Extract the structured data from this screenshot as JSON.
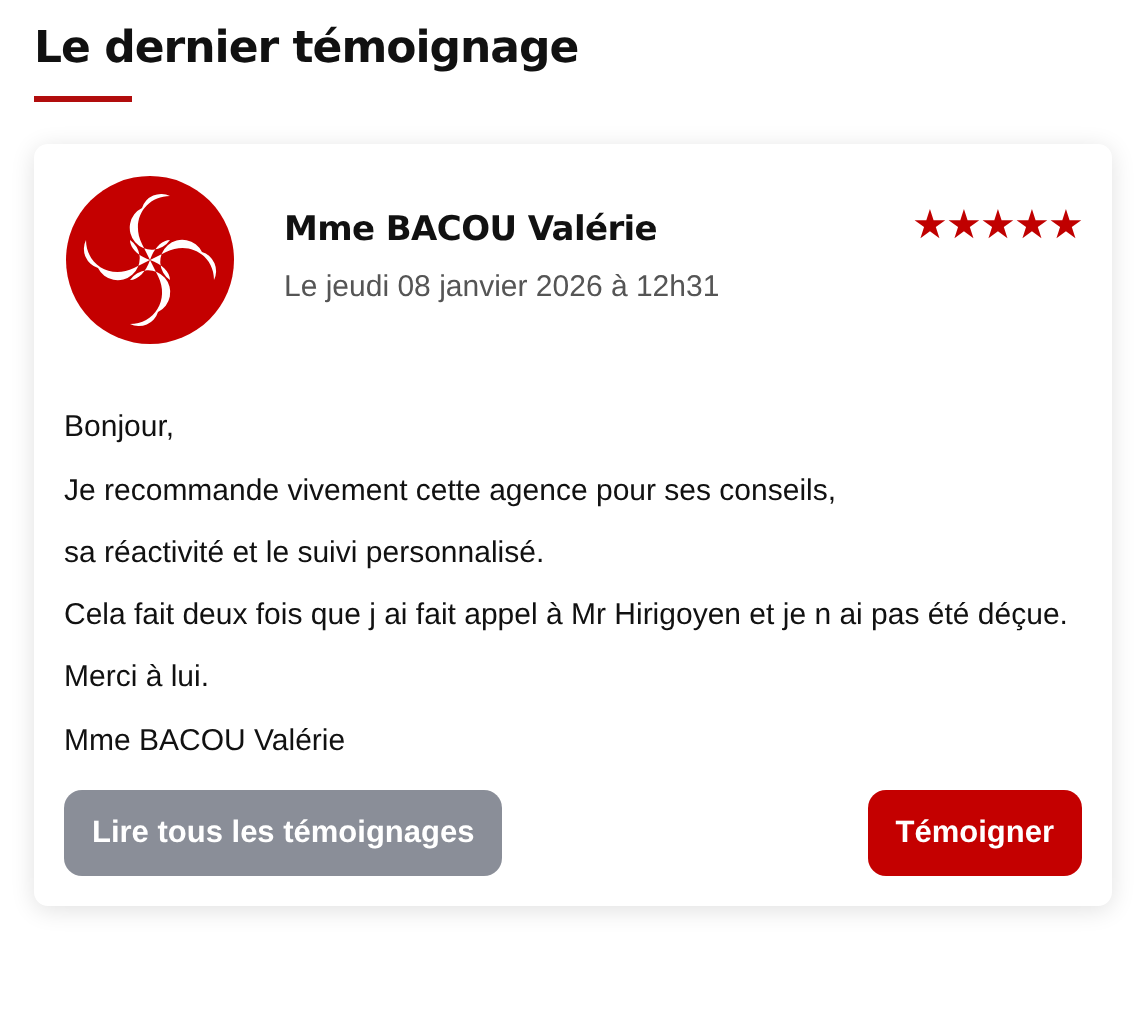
{
  "section_title": "Le dernier témoignage",
  "testimonial": {
    "author": "Mme BACOU Valérie",
    "date": "Le jeudi 08 janvier 2026 à 12h31",
    "stars": 5,
    "paragraphs": [
      "Bonjour,",
      "Je recommande vivement cette agence pour ses conseils,",
      "sa réactivité et le suivi personnalisé.",
      "Cela fait deux fois que j ai fait appel à Mr Hirigoyen et je n ai pas été déçue.",
      "Merci à lui.",
      "Mme BACOU Valérie"
    ]
  },
  "buttons": [
    {
      "label": "Lire tous les témoignages",
      "kind": "secondary"
    },
    {
      "label": "Témoigner",
      "kind": "primary"
    }
  ]
}
